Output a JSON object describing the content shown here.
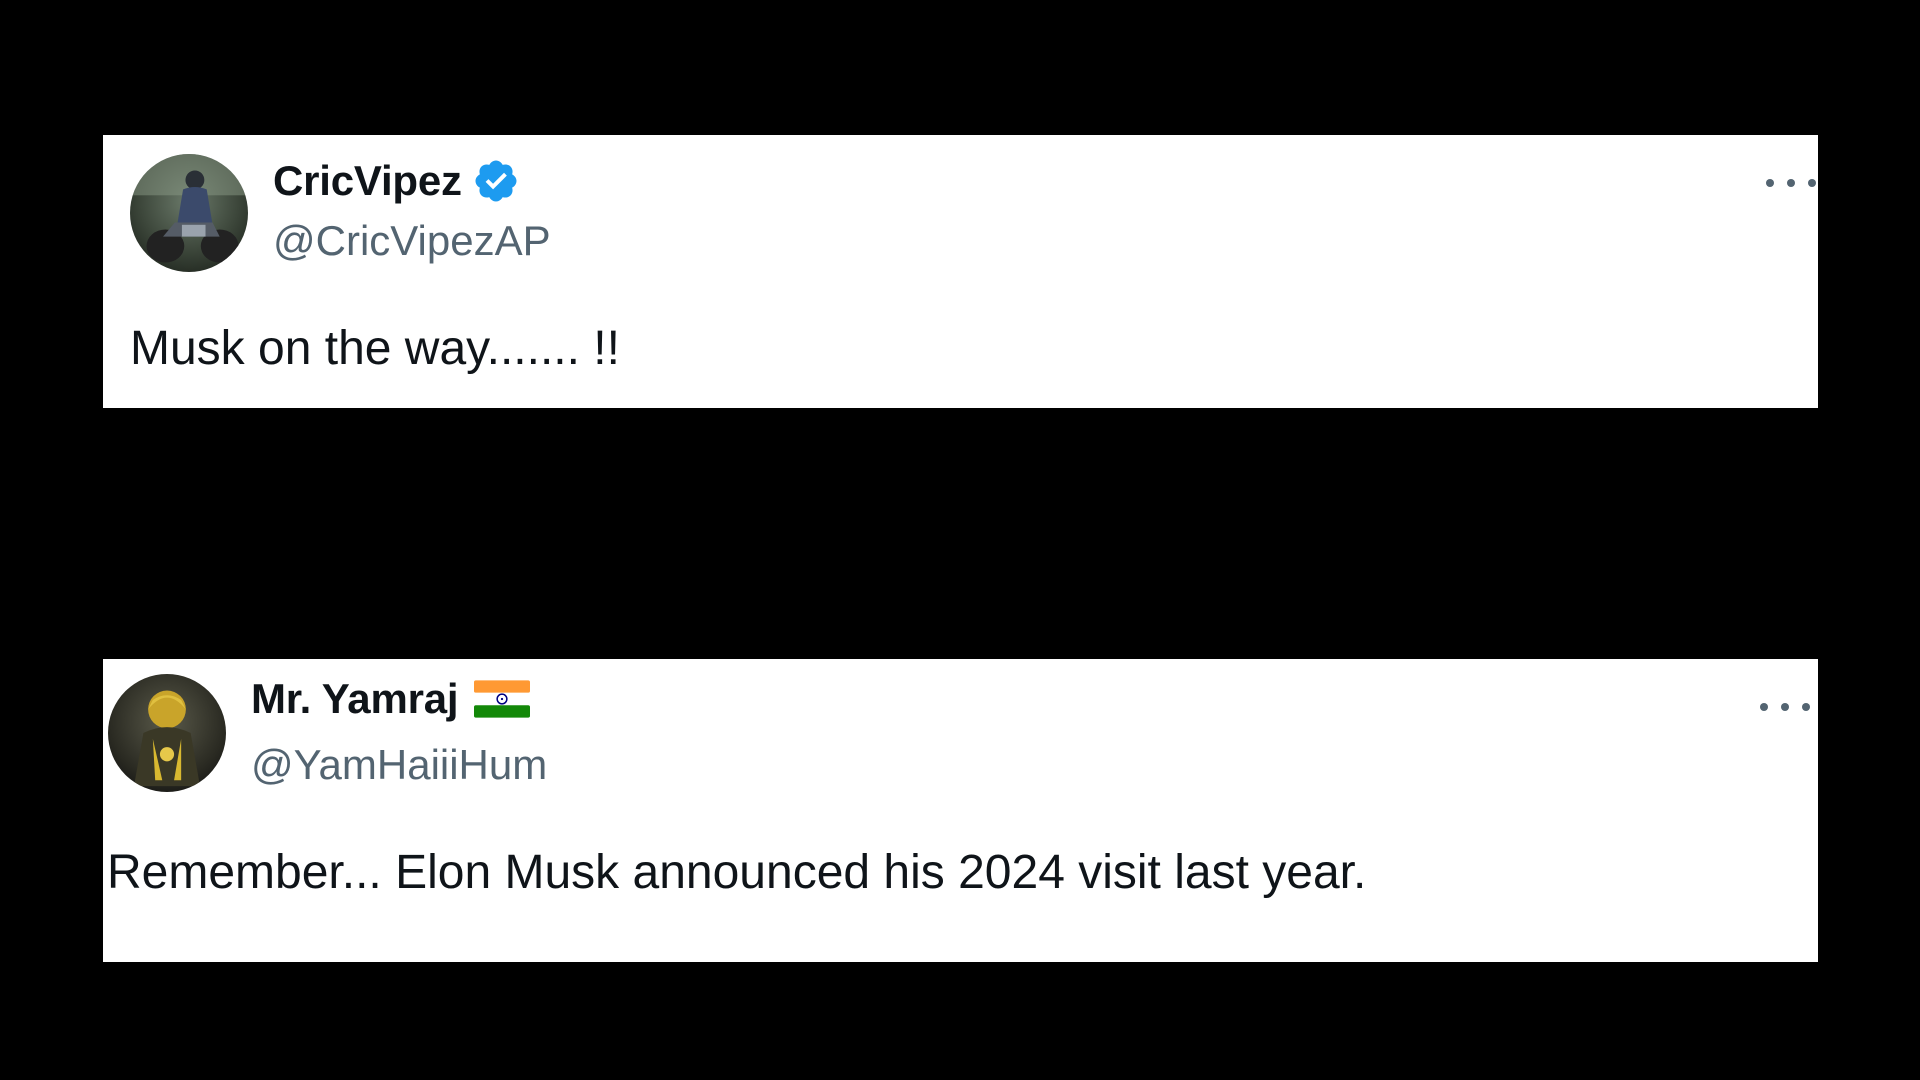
{
  "tweets": [
    {
      "display_name": "CricVipez",
      "handle": "@CricVipezAP",
      "badge": "verified-icon",
      "text": "Musk on the way....... !!",
      "more_icon": "more-options-icon"
    },
    {
      "display_name": "Mr. Yamraj",
      "handle": "@YamHaiiiHum",
      "badge": "india-flag-icon",
      "text": "Remember... Elon Musk announced his 2024 visit last year.",
      "more_icon": "more-options-icon"
    }
  ],
  "colors": {
    "background": "#000000",
    "card": "#ffffff",
    "name": "#0f1419",
    "handle": "#536471",
    "verified": "#1d9bf0",
    "flag_saffron": "#ff9933",
    "flag_green": "#138808",
    "flag_chakra": "#000080"
  }
}
